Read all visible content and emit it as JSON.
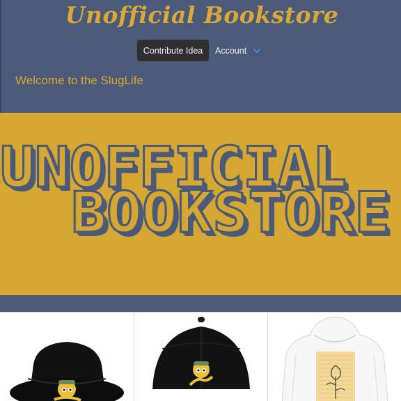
{
  "header": {
    "site_title": "Unofficial Bookstore",
    "welcome_text": "Welcome to the SlugLife"
  },
  "nav": {
    "contribute_label": "Contribute Idea",
    "account_label": "Account"
  },
  "hero": {
    "line1": "UNOFFICIAL",
    "line2": "BOOKSTORE"
  },
  "products": [
    {
      "kind": "bucket-hat",
      "color": "black"
    },
    {
      "kind": "baseball-cap",
      "color": "black"
    },
    {
      "kind": "hoodie",
      "color": "white"
    }
  ],
  "colors": {
    "header_bg": "#4b5a78",
    "accent_gold": "#d8a838",
    "hero_bg": "#d6a733",
    "button_dark": "#2f2f31",
    "chevron_blue": "#4a8cff"
  }
}
